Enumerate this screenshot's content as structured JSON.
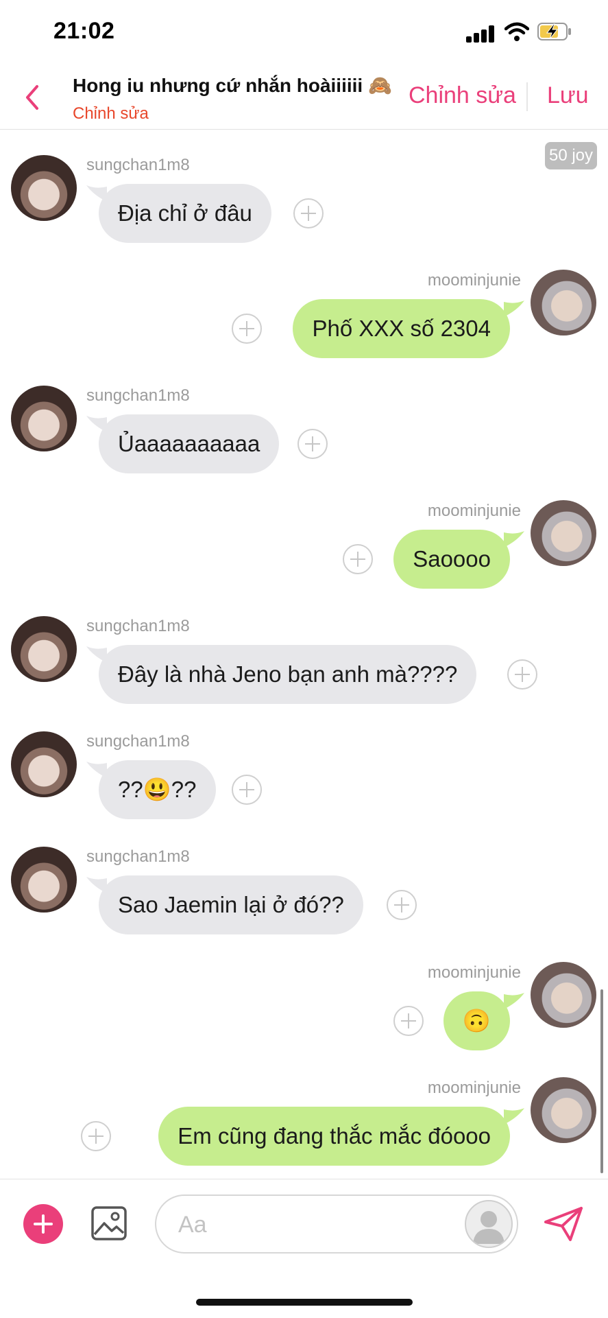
{
  "status_bar": {
    "time": "21:02"
  },
  "header": {
    "title": "Hong iu nhưng cứ nhắn hoàiiiiii 🙈",
    "subtitle": "Chỉnh sửa",
    "edit_label": "Chỉnh sửa",
    "save_label": "Lưu"
  },
  "chat": {
    "cost_badge": "50 joy",
    "messages": [
      {
        "side": "in",
        "user": "sungchan1m8",
        "text": "Địa chỉ ở đâu"
      },
      {
        "side": "out",
        "user": "moominjunie",
        "text": "Phố XXX số 2304"
      },
      {
        "side": "in",
        "user": "sungchan1m8",
        "text": "Ủaaaaaaaaaa"
      },
      {
        "side": "out",
        "user": "moominjunie",
        "text": "Saoooo"
      },
      {
        "side": "in",
        "user": "sungchan1m8",
        "text": "Đây là nhà Jeno bạn anh mà????"
      },
      {
        "side": "in",
        "user": "sungchan1m8",
        "text": "??😃??"
      },
      {
        "side": "in",
        "user": "sungchan1m8",
        "text": "Sao Jaemin lại ở đó??"
      },
      {
        "side": "out",
        "user": "moominjunie",
        "text": "🙃"
      },
      {
        "side": "out",
        "user": "moominjunie",
        "text": "Em cũng đang thắc mắc đóooo"
      }
    ]
  },
  "composer": {
    "placeholder": "Aa"
  },
  "colors": {
    "accent": "#ea3f7a",
    "incoming_bubble": "#e7e7ea",
    "outgoing_bubble": "#c6ed8e",
    "subtitle": "#e8472b"
  },
  "icons": {
    "back": "chevron-left-icon",
    "add": "plus-icon",
    "image": "image-icon",
    "send": "send-icon",
    "react": "add-reaction-icon"
  }
}
